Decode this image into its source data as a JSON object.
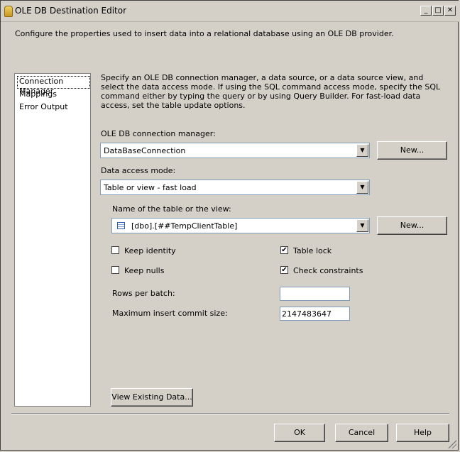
{
  "window": {
    "title": "OLE DB Destination Editor",
    "minimize_glyph": "_",
    "maximize_glyph": "□",
    "close_glyph": "✕"
  },
  "intro": "Configure the properties used to insert data into a relational database using an OLE DB provider.",
  "nav": {
    "items": [
      {
        "label": "Connection Manager",
        "selected": true
      },
      {
        "label": "Mappings"
      },
      {
        "label": "Error Output"
      }
    ]
  },
  "description": "Specify an OLE DB connection manager, a data source, or a data source view, and select the data access mode. If using the SQL command access mode, specify the SQL command either by typing the query or by using Query Builder. For fast-load data access, set the table update options.",
  "connection_manager": {
    "label": "OLE DB connection manager:",
    "value": "DataBaseConnection",
    "new_label": "New..."
  },
  "access_mode": {
    "label": "Data access mode:",
    "value": "Table or view - fast load"
  },
  "table": {
    "label": "Name of the table or the view:",
    "value": "[dbo].[##TempClientTable]",
    "new_label": "New..."
  },
  "options": {
    "keep_identity": {
      "label": "Keep identity",
      "checked": false
    },
    "keep_nulls": {
      "label": "Keep nulls",
      "checked": false
    },
    "table_lock": {
      "label": "Table lock",
      "checked": true
    },
    "check_constraints": {
      "label": "Check constraints",
      "checked": true
    }
  },
  "rows_per_batch": {
    "label": "Rows per batch:",
    "value": ""
  },
  "max_commit": {
    "label": "Maximum insert commit size:",
    "value": "2147483647"
  },
  "view_data_label": "View Existing Data...",
  "footer": {
    "ok": "OK",
    "cancel": "Cancel",
    "help": "Help"
  },
  "check_glyph": "✔",
  "arrow_glyph": "▼"
}
